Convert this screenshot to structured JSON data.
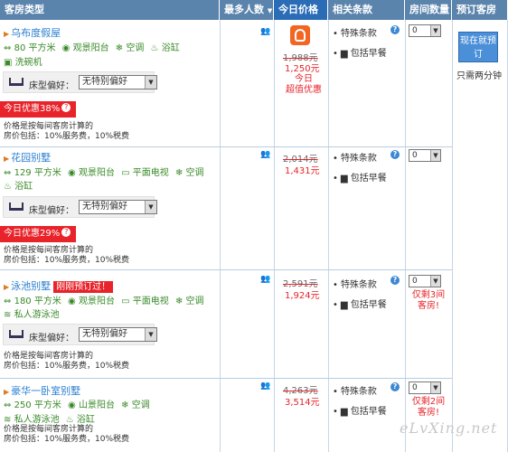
{
  "header": {
    "room_type": "客房类型",
    "max_guests": "最多人数",
    "today_price": "今日价格",
    "sort_icon": "triangle-down",
    "terms": "相关条款",
    "room_qty": "房间数量",
    "book": "预订客房"
  },
  "book": {
    "button": "现在就预订",
    "note": "只需两分钟"
  },
  "rooms": [
    {
      "name": "乌布度假屋",
      "amenities_line1": [
        "80 平方米",
        "观景阳台",
        "空调",
        "浴缸"
      ],
      "amenities_line2": [
        "洗碗机"
      ],
      "bed_label": "床型偏好：",
      "bed_value": "无特别偏好",
      "discount": "今日优惠38%",
      "note1": "价格是按每间客房计算的",
      "note2": "房价包括：10%服务费，10%税费",
      "old_price": "1,988元",
      "new_price": "1,250元",
      "price_tag1": "今日",
      "price_tag2": "超值优惠",
      "term1": "特殊条款",
      "term2": "包括早餐",
      "qty": "0"
    },
    {
      "name": "花园别墅",
      "amenities_line1": [
        "129 平方米",
        "观景阳台",
        "平面电视",
        "空调"
      ],
      "amenities_line2": [
        "浴缸"
      ],
      "bed_label": "床型偏好：",
      "bed_value": "无特别偏好",
      "discount": "今日优惠29%",
      "note1": "价格是按每间客房计算的",
      "note2": "房价包括：10%服务费，10%税费",
      "old_price": "2,014元",
      "new_price": "1,431元",
      "term1": "特殊条款",
      "term2": "包括早餐",
      "qty": "0"
    },
    {
      "name": "泳池别墅",
      "alert": "刚刚预订过！",
      "amenities_line1": [
        "180 平方米",
        "观景阳台",
        "平面电视",
        "空调"
      ],
      "amenities_line2": [
        "私人游泳池"
      ],
      "bed_label": "床型偏好：",
      "bed_value": "无特别偏好",
      "note1": "价格是按每间客房计算的",
      "note2": "房价包括：10%服务费，10%税费",
      "old_price": "2,591元",
      "new_price": "1,924元",
      "term1": "特殊条款",
      "term2": "包括早餐",
      "qty": "0",
      "scarcity1": "仅剩3间",
      "scarcity2": "客房!"
    },
    {
      "name": "豪华一卧室别墅",
      "amenities_line1": [
        "250 平方米",
        "山景阳台",
        "空调"
      ],
      "amenities_line2": [
        "私人游泳池",
        "浴缸"
      ],
      "note1": "价格是按每间客房计算的",
      "note2": "房价包括：10%服务费，10%税费",
      "old_price": "4,263元",
      "new_price": "3,514元",
      "term1": "特殊条款",
      "term2": "包括早餐",
      "qty": "0",
      "scarcity1": "仅剩2间",
      "scarcity2": "客房!"
    }
  ],
  "watermark": "eLvXing.net",
  "colors": {
    "header": "#5b84ad",
    "header_highlight": "#2b6cb7",
    "link": "#2a7fd0",
    "amenity": "#3a8a2a",
    "discount": "#e8232a",
    "book_button": "#4a8fd8"
  }
}
